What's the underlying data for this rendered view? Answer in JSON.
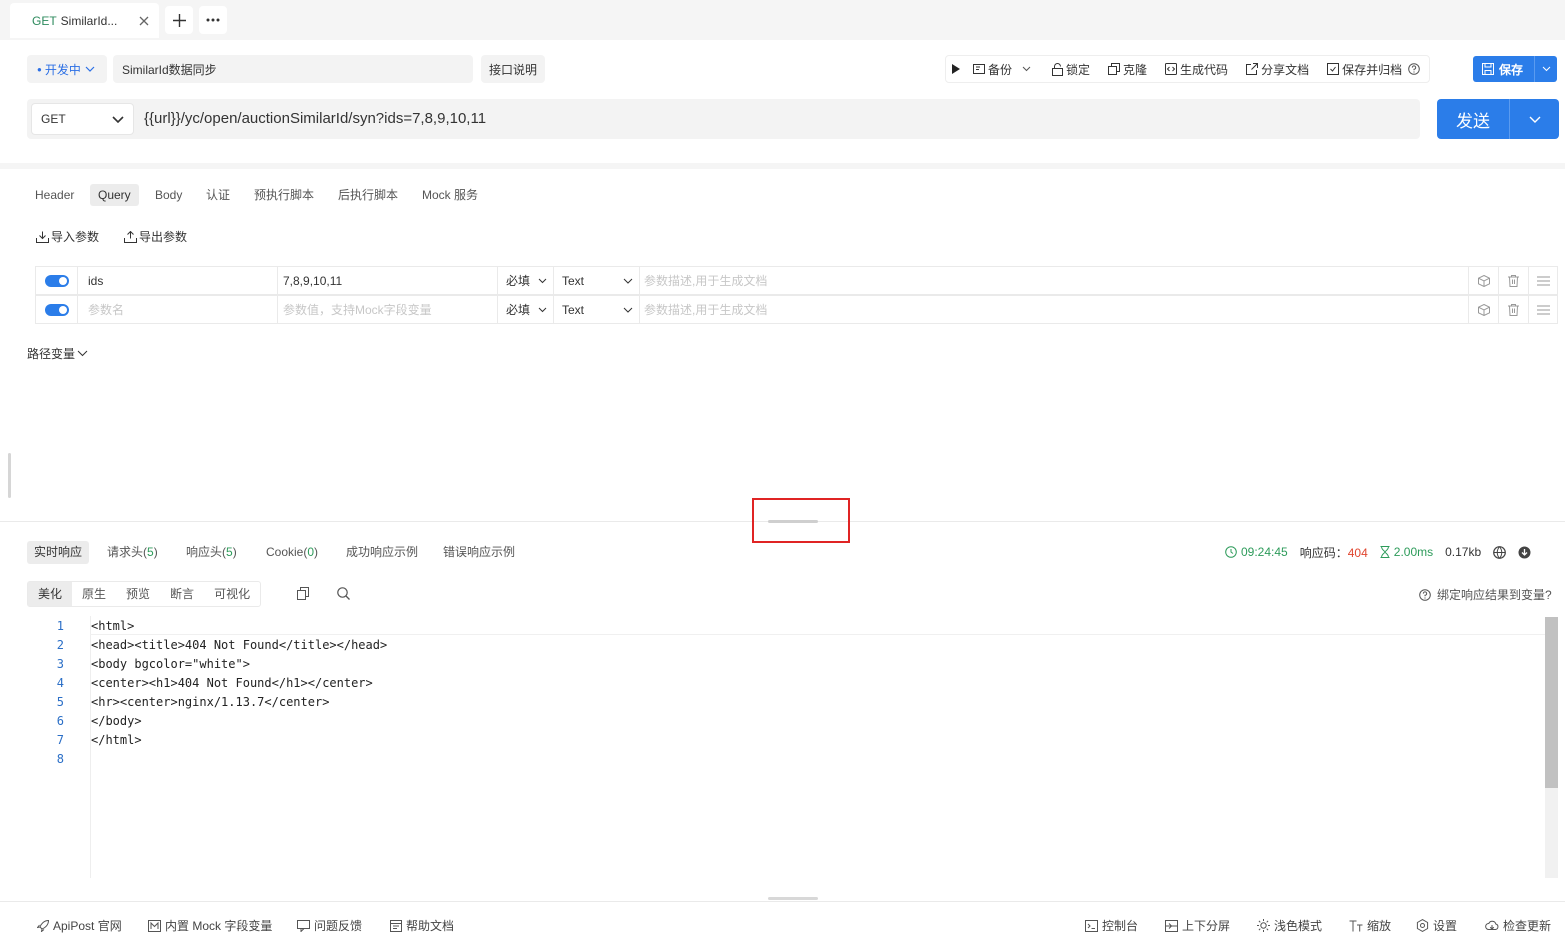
{
  "tab": {
    "method": "GET",
    "title": "SimilarId...",
    "add_label": "+",
    "more_label": "···"
  },
  "toolbar": {
    "status": "开发中",
    "name": "SimilarId数据同步",
    "desc_button": "接口说明",
    "actions": {
      "backup": "备份",
      "lock": "锁定",
      "clone": "克隆",
      "gen_code": "生成代码",
      "share": "分享文档",
      "save_archive": "保存并归档"
    },
    "save": "保存"
  },
  "request": {
    "method": "GET",
    "url": "{{url}}/yc/open/auctionSimilarId/syn?ids=7,8,9,10,11",
    "send": "发送"
  },
  "request_tabs": [
    {
      "label": "Header",
      "active": false
    },
    {
      "label": "Query",
      "active": true
    },
    {
      "label": "Body",
      "active": false
    },
    {
      "label": "认证",
      "active": false
    },
    {
      "label": "预执行脚本",
      "active": false
    },
    {
      "label": "后执行脚本",
      "active": false
    },
    {
      "label": "Mock 服务",
      "active": false
    }
  ],
  "param_ops": {
    "import": "导入参数",
    "export": "导出参数"
  },
  "params": [
    {
      "enabled": true,
      "name": "ids",
      "value": "7,8,9,10,11",
      "required": "必填",
      "type": "Text",
      "desc_placeholder": "参数描述,用于生成文档"
    },
    {
      "enabled": true,
      "name_placeholder": "参数名",
      "value_placeholder": "参数值，支持Mock字段变量",
      "required": "必填",
      "type": "Text",
      "desc_placeholder": "参数描述,用于生成文档"
    }
  ],
  "path_vars_label": "路径变量",
  "response_tabs": {
    "realtime": "实时响应",
    "req_headers": "请求头",
    "req_headers_count": "5",
    "resp_headers": "响应头",
    "resp_headers_count": "5",
    "cookie": "Cookie",
    "cookie_count": "0",
    "success_example": "成功响应示例",
    "error_example": "错误响应示例"
  },
  "response_meta": {
    "time": "09:24:45",
    "code_label": "响应码：",
    "code": "404",
    "duration": "2.00ms",
    "size": "0.17kb"
  },
  "view_tabs": [
    {
      "label": "美化",
      "active": true
    },
    {
      "label": "原生",
      "active": false
    },
    {
      "label": "预览",
      "active": false
    },
    {
      "label": "断言",
      "active": false
    },
    {
      "label": "可视化",
      "active": false
    }
  ],
  "bind_link": "绑定响应结果到变量?",
  "code_lines": [
    "<html>",
    "<head><title>404 Not Found</title></head>",
    "<body bgcolor=\"white\">",
    "<center><h1>404 Not Found</h1></center>",
    "<hr><center>nginx/1.13.7</center>",
    "</body>",
    "</html>",
    ""
  ],
  "line_numbers": [
    "1",
    "2",
    "3",
    "4",
    "5",
    "6",
    "7",
    "8"
  ],
  "footer": {
    "official": "ApiPost 官网",
    "mock_vars": "内置 Mock 字段变量",
    "feedback": "问题反馈",
    "help": "帮助文档",
    "console": "控制台",
    "split": "上下分屏",
    "theme": "浅色模式",
    "zoom": "缩放",
    "settings": "设置",
    "update": "检查更新"
  },
  "colors": {
    "accent": "#2b7de9",
    "success": "#2d9b5a",
    "error": "#e0452f"
  },
  "icons": [
    "close-icon",
    "plus-icon",
    "more-icon",
    "chevron-down-icon",
    "play-icon",
    "backup-icon",
    "lock-icon",
    "clone-icon",
    "code-icon",
    "share-icon",
    "archive-icon",
    "help-icon",
    "save-icon",
    "import-icon",
    "export-icon",
    "cube-icon",
    "trash-icon",
    "drag-icon",
    "clock-icon",
    "hourglass-icon",
    "globe-icon",
    "download-icon",
    "copy-icon",
    "search-icon",
    "question-icon"
  ]
}
